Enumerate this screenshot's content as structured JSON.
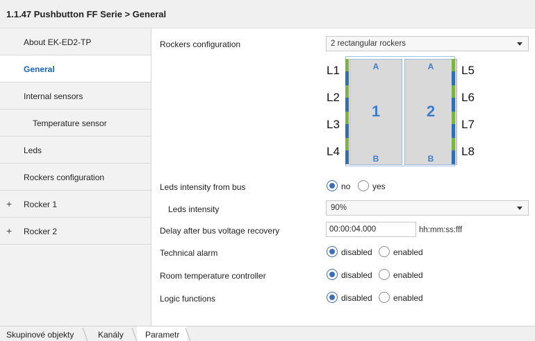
{
  "header": {
    "title": "1.1.47 Pushbutton FF Serie > General"
  },
  "sidebar": {
    "items": [
      {
        "label": "About EK-ED2-TP"
      },
      {
        "label": "General"
      },
      {
        "label": "Internal sensors"
      },
      {
        "label": "Temperature sensor"
      },
      {
        "label": "Leds"
      },
      {
        "label": "Rockers configuration"
      },
      {
        "label": "Rocker 1",
        "expand": "+"
      },
      {
        "label": "Rocker 2",
        "expand": "+"
      }
    ],
    "active_index": 1
  },
  "settings": {
    "rockers_configuration": {
      "label": "Rockers configuration",
      "value": "2 rectangular rockers"
    },
    "leds_from_bus": {
      "label": "Leds intensity from bus",
      "options": [
        "no",
        "yes"
      ],
      "selected": "no"
    },
    "leds_intensity": {
      "label": "Leds intensity",
      "value": "90%"
    },
    "delay": {
      "label": "Delay after bus voltage recovery",
      "value": "00:00:04.000",
      "unit": "hh:mm:ss:fff"
    },
    "technical_alarm": {
      "label": "Technical alarm",
      "options": [
        "disabled",
        "enabled"
      ],
      "selected": "disabled"
    },
    "room_temp_controller": {
      "label": "Room temperature controller",
      "options": [
        "disabled",
        "enabled"
      ],
      "selected": "disabled"
    },
    "logic_functions": {
      "label": "Logic functions",
      "options": [
        "disabled",
        "enabled"
      ],
      "selected": "disabled"
    }
  },
  "diagram": {
    "left_labels": [
      "L1",
      "L2",
      "L3",
      "L4"
    ],
    "right_labels": [
      "L5",
      "L6",
      "L7",
      "L8"
    ],
    "rockers": [
      {
        "top": "A",
        "number": "1",
        "bottom": "B"
      },
      {
        "top": "A",
        "number": "2",
        "bottom": "B"
      }
    ],
    "colors": {
      "led_green": "#7cb342",
      "led_blue": "#2e6fb8",
      "rocker_text": "#3d7cc9"
    }
  },
  "bottom_tabs": [
    {
      "label": "Skupinové objekty"
    },
    {
      "label": "Kanály"
    },
    {
      "label": "Parametr"
    }
  ],
  "colors": {
    "accent": "#1565c0",
    "radio_selected": "#3d6fb4"
  }
}
